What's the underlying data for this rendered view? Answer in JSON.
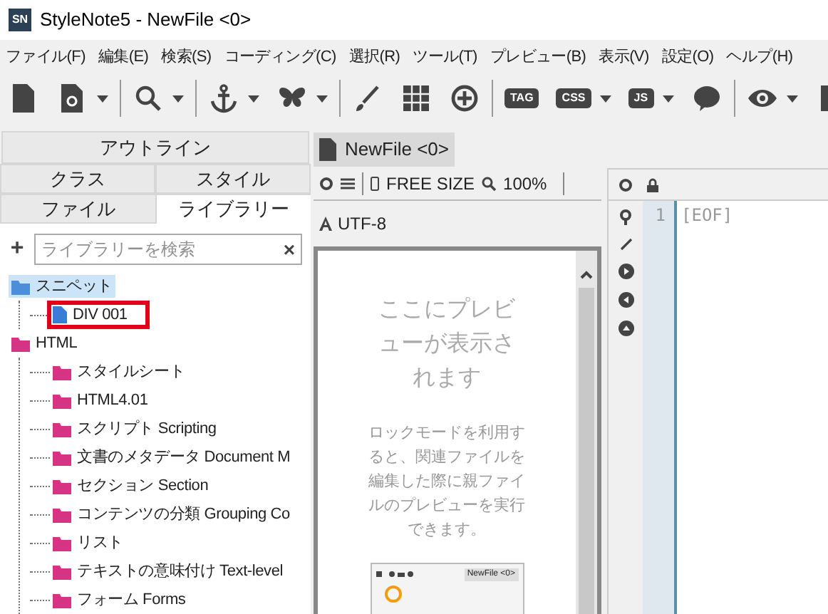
{
  "window": {
    "title": "StyleNote5 - NewFile <0>",
    "app_icon_label": "SN"
  },
  "menu": [
    "ファイル(F)",
    "編集(E)",
    "検索(S)",
    "コーディング(C)",
    "選択(R)",
    "ツール(T)",
    "プレビュー(B)",
    "表示(V)",
    "設定(O)",
    "ヘルプ(H)"
  ],
  "toolbar": [
    [
      {
        "kind": "new-file",
        "dropdown": false
      },
      {
        "kind": "reload-file",
        "dropdown": true
      }
    ],
    [
      {
        "kind": "search",
        "dropdown": true
      }
    ],
    [
      {
        "kind": "anchor",
        "dropdown": true
      },
      {
        "kind": "butterfly",
        "dropdown": true
      }
    ],
    [
      {
        "kind": "brush",
        "dropdown": false
      },
      {
        "kind": "grid",
        "dropdown": false
      },
      {
        "kind": "plus-circle",
        "dropdown": false
      }
    ],
    [
      {
        "kind": "text",
        "label": "TAG",
        "dropdown": false
      },
      {
        "kind": "text",
        "label": "CSS",
        "dropdown": true
      },
      {
        "kind": "text",
        "label": "JS",
        "dropdown": true
      },
      {
        "kind": "speech",
        "dropdown": false
      }
    ],
    [
      {
        "kind": "eye",
        "dropdown": true
      },
      {
        "kind": "page",
        "dropdown": false
      }
    ]
  ],
  "left_panel": {
    "header": "アウトライン",
    "tabs": [
      [
        {
          "label": "クラス",
          "selected": false
        },
        {
          "label": "スタイル",
          "selected": false
        }
      ],
      [
        {
          "label": "ファイル",
          "selected": false
        },
        {
          "label": "ライブラリー",
          "selected": true
        }
      ]
    ],
    "add_button": "+",
    "search": {
      "placeholder": "ライブラリーを検索",
      "clear": "×"
    },
    "tree": [
      {
        "label": "スニペット",
        "kind": "folder",
        "color": "#4a8fd8",
        "selected": true,
        "children": [
          {
            "label": "DIV 001",
            "kind": "file",
            "selected": false,
            "annotated": true
          }
        ]
      },
      {
        "label": "HTML",
        "kind": "folder",
        "color": "#d63384",
        "selected": false,
        "children": [
          {
            "label": "スタイルシート",
            "kind": "folder",
            "color": "#d63384",
            "selected": false
          },
          {
            "label": "HTML4.01",
            "kind": "folder",
            "color": "#d63384",
            "selected": false
          },
          {
            "label": "スクリプト Scripting",
            "kind": "folder",
            "color": "#d63384",
            "selected": false
          },
          {
            "label": "文書のメタデータ Document M",
            "kind": "folder",
            "color": "#d63384",
            "selected": false
          },
          {
            "label": "セクション Section",
            "kind": "folder",
            "color": "#d63384",
            "selected": false
          },
          {
            "label": "コンテンツの分類 Grouping Co",
            "kind": "folder",
            "color": "#d63384",
            "selected": false
          },
          {
            "label": "リスト",
            "kind": "folder",
            "color": "#d63384",
            "selected": false
          },
          {
            "label": "テキストの意味付け Text-level",
            "kind": "folder",
            "color": "#d63384",
            "selected": false
          },
          {
            "label": "フォーム Forms",
            "kind": "folder",
            "color": "#d63384",
            "selected": false
          }
        ]
      }
    ]
  },
  "preview": {
    "tab": "NewFile <0>",
    "size": "FREE SIZE",
    "zoom": "100%",
    "encoding": "UTF-8",
    "empty_message": "ここにプレビューが表示されます",
    "lock_hint": "ロックモードを利用すると、関連ファイルを編集した際に親ファイルのプレビューを実行できます。",
    "hint_image_tab": "NewFile <0>"
  },
  "editor": {
    "lines": [
      {
        "number": "1",
        "text": "[EOF]"
      }
    ]
  }
}
